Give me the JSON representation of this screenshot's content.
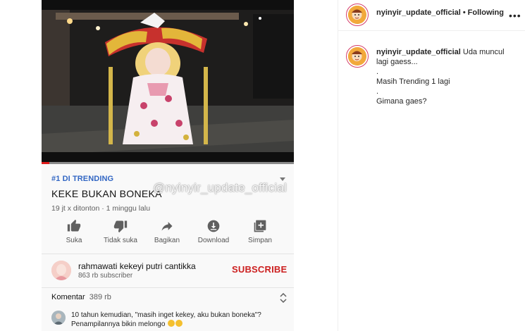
{
  "video": {
    "progress_fraction": 0.03,
    "watermark": "@nyinyir_update_official"
  },
  "youtube": {
    "trending": "#1 DI TRENDING",
    "title": "KEKE BUKAN BONEKA",
    "meta": "19 jt x ditonton · 1 minggu lalu",
    "actions": [
      {
        "label": "Suka",
        "icon": "thumbs-up-icon"
      },
      {
        "label": "Tidak suka",
        "icon": "thumbs-down-icon"
      },
      {
        "label": "Bagikan",
        "icon": "share-icon"
      },
      {
        "label": "Download",
        "icon": "download-icon"
      },
      {
        "label": "Simpan",
        "icon": "add-to-playlist-icon"
      }
    ],
    "channel": {
      "name": "rahmawati kekeyi putri cantikka",
      "subscribers": "863 rb subscriber",
      "subscribe_label": "SUBSCRIBE"
    },
    "comments": {
      "label": "Komentar",
      "count": "389 rb",
      "top_comment_line1": "10 tahun kemudian, \"masih inget kekey, aku bukan boneka\"?",
      "top_comment_line2": "Penampilannya bikin melongo"
    }
  },
  "instagram": {
    "username": "nyinyir_update_official",
    "separator": "•",
    "follow_status": "Following",
    "caption": {
      "first_line": "Uda muncul lagi gaess...",
      "lines": [
        ".",
        "Masih Trending 1 lagi",
        ".",
        "Gimana gaes?"
      ]
    }
  },
  "colors": {
    "trending": "#3367c4",
    "subscribe": "#cc1f1f",
    "progress": "#e01b1b"
  }
}
